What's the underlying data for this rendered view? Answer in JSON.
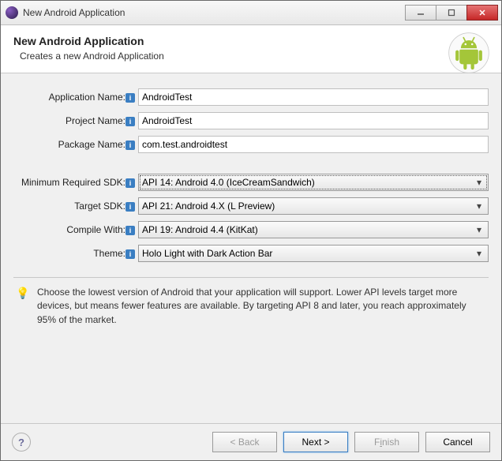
{
  "window": {
    "title": "New Android Application"
  },
  "header": {
    "title": "New Android Application",
    "subtitle": "Creates a new Android Application"
  },
  "fields": {
    "app_name": {
      "label": "Application Name:",
      "value": "AndroidTest"
    },
    "project_name": {
      "label": "Project Name:",
      "value": "AndroidTest"
    },
    "package_name": {
      "label": "Package Name:",
      "value": "com.test.androidtest"
    },
    "min_sdk": {
      "label": "Minimum Required SDK:",
      "value": "API 14: Android 4.0 (IceCreamSandwich)"
    },
    "target_sdk": {
      "label": "Target SDK:",
      "value": "API 21: Android 4.X (L Preview)"
    },
    "compile_with": {
      "label": "Compile With:",
      "value": "API 19: Android 4.4 (KitKat)"
    },
    "theme": {
      "label": "Theme:",
      "value": "Holo Light with Dark Action Bar"
    }
  },
  "hint": "Choose the lowest version of Android that your application will support. Lower API levels target more devices, but means fewer features are available. By targeting API 8 and later, you reach approximately 95% of the market.",
  "buttons": {
    "back": "< Back",
    "next": "Next >",
    "finish_pre": "F",
    "finish_mid": "i",
    "finish_post": "nish",
    "cancel": "Cancel"
  }
}
